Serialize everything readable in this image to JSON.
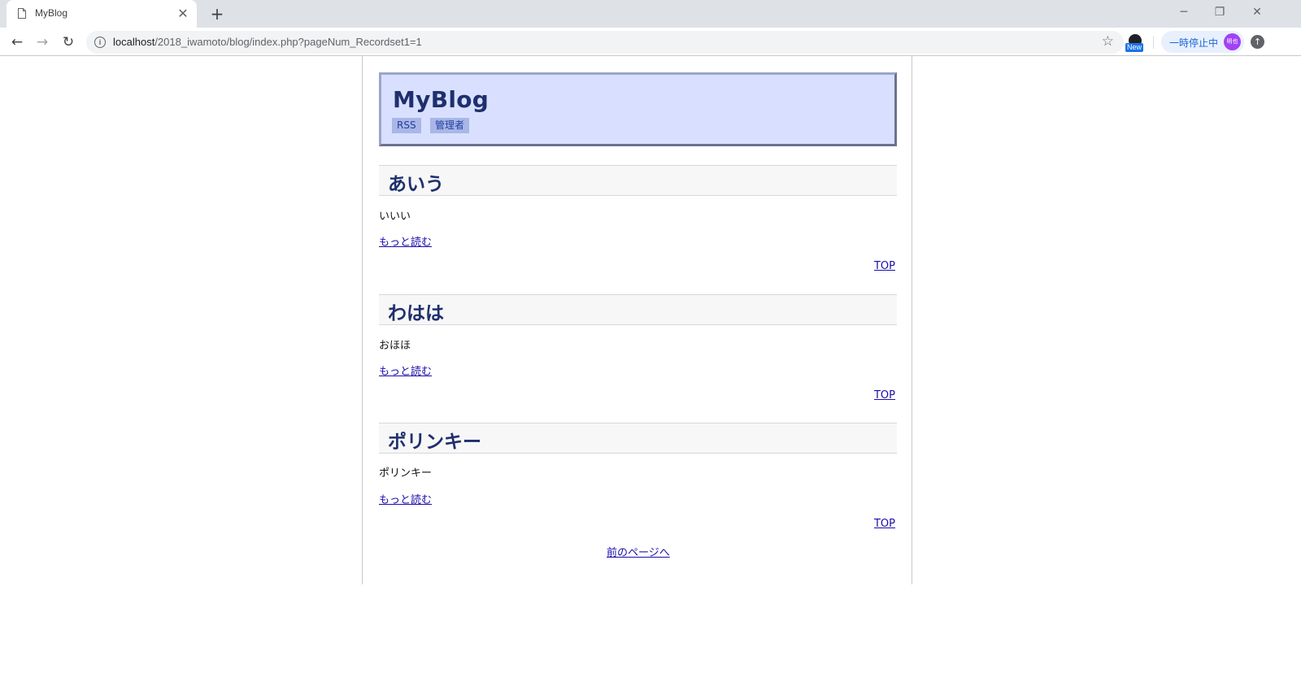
{
  "browser": {
    "tab_title": "MyBlog",
    "new_tab_symbol": "+",
    "url_host": "localhost",
    "url_path": "/2018_iwamoto/blog/index.php?pageNum_Recordset1=1",
    "extension_badge": "New",
    "profile_status": "一時停止中",
    "avatar_text": "明也"
  },
  "blog": {
    "title": "MyBlog",
    "nav": [
      "RSS",
      "管理者"
    ],
    "posts": [
      {
        "title": "あいう",
        "body": "いいい",
        "more": "もっと読む",
        "top": "TOP"
      },
      {
        "title": "わはは",
        "body": "おほほ",
        "more": "もっと読む",
        "top": "TOP"
      },
      {
        "title": "ポリンキー",
        "body": "ポリンキー",
        "more": "もっと読む",
        "top": "TOP"
      }
    ],
    "prev_page": "前のページへ"
  },
  "colors": {
    "header_bg": "#d9e0ff",
    "title_color": "#1f2f6e",
    "link_color": "#1a0dab"
  }
}
